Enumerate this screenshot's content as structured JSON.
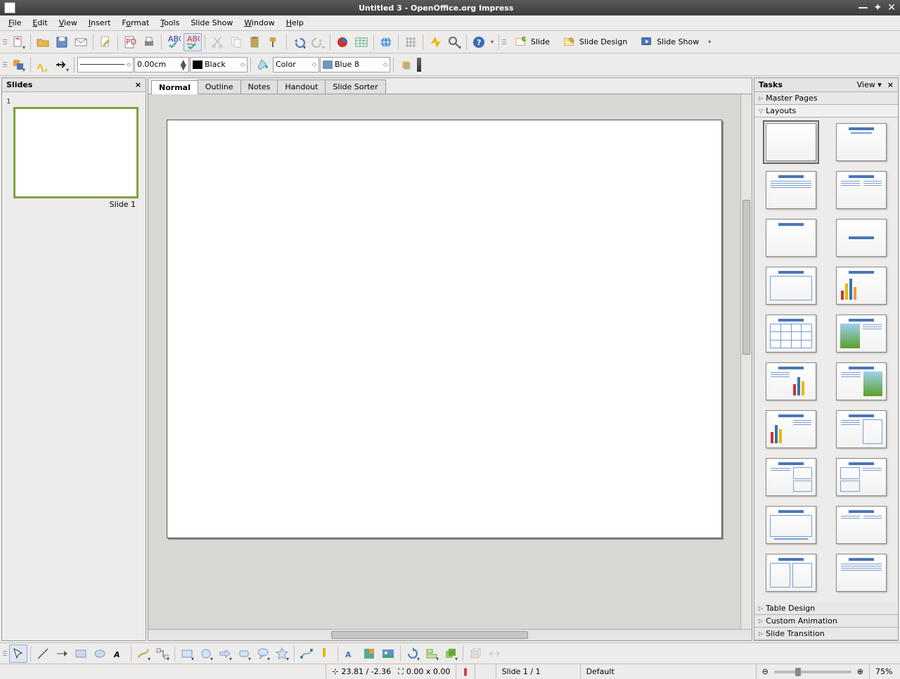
{
  "window": {
    "title": "Untitled 3 - OpenOffice.org Impress"
  },
  "menu": {
    "file": "File",
    "edit": "Edit",
    "view": "View",
    "insert": "Insert",
    "format": "Format",
    "tools": "Tools",
    "slideshow": "Slide Show",
    "window": "Window",
    "help": "Help"
  },
  "toolbar1": {
    "slide": "Slide",
    "slide_design": "Slide Design",
    "slide_show": "Slide Show"
  },
  "toolbar2": {
    "width": "0.00cm",
    "linecolor": "Black",
    "fillmode": "Color",
    "fillcolor": "Blue 8"
  },
  "slides_panel": {
    "title": "Slides",
    "slide_label": "Slide 1",
    "num": "1"
  },
  "view_tabs": {
    "normal": "Normal",
    "outline": "Outline",
    "notes": "Notes",
    "handout": "Handout",
    "sorter": "Slide Sorter"
  },
  "tasks": {
    "title": "Tasks",
    "view": "View",
    "master": "Master Pages",
    "layouts": "Layouts",
    "table_design": "Table Design",
    "custom_anim": "Custom Animation",
    "transition": "Slide Transition"
  },
  "status": {
    "coords": "23.81 / -2.36",
    "size": "0.00 x 0.00",
    "slide": "Slide 1 / 1",
    "template": "Default",
    "zoom": "75%"
  }
}
